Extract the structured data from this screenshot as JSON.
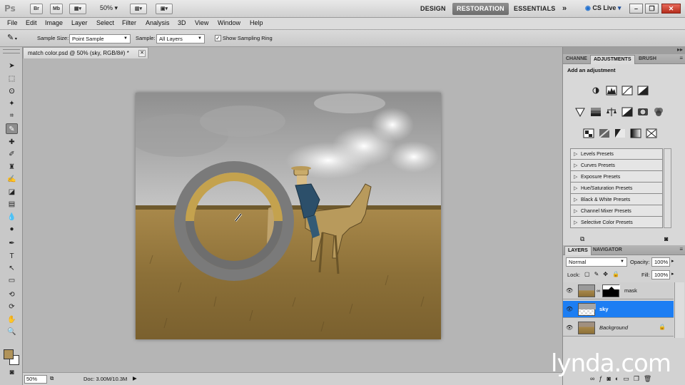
{
  "app": {
    "logo": "Ps",
    "bridge_btn": "Br",
    "minibridge_btn": "Mb",
    "zoom": "50%",
    "workspaces": [
      "DESIGN",
      "RESTORATION",
      "ESSENTIALS"
    ],
    "active_workspace": "RESTORATION",
    "more_workspaces": "»",
    "cs_live": "CS Live"
  },
  "menu": [
    "File",
    "Edit",
    "Image",
    "Layer",
    "Select",
    "Filter",
    "Analysis",
    "3D",
    "View",
    "Window",
    "Help"
  ],
  "options": {
    "sample_size_label": "Sample Size:",
    "sample_size_value": "Point Sample",
    "sample_label": "Sample:",
    "sample_value": "All Layers",
    "show_ring_label": "Show Sampling Ring"
  },
  "document": {
    "tab_title": "match color.psd @ 50% (sky, RGB/8#) *",
    "status_zoom": "50%",
    "status_doc": "Doc: 3.00M/10.3M"
  },
  "colors": {
    "foreground": "#b0935a",
    "background": "#ffffff",
    "ring_top": "#c4a24e",
    "ring_bottom": "#6e6e6e"
  },
  "adjustments": {
    "tabs": [
      "CHANNE",
      "ADJUSTMENTS",
      "BRUSH"
    ],
    "header": "Add an adjustment",
    "presets": [
      "Levels Presets",
      "Curves Presets",
      "Exposure Presets",
      "Hue/Saturation Presets",
      "Black & White Presets",
      "Channel Mixer Presets",
      "Selective Color Presets"
    ]
  },
  "layers": {
    "tabs": [
      "LAYERS",
      "NAVIGATOR"
    ],
    "blend_mode": "Normal",
    "opacity_label": "Opacity:",
    "opacity_value": "100%",
    "lock_label": "Lock:",
    "fill_label": "Fill:",
    "fill_value": "100%",
    "items": [
      {
        "name": "mask",
        "selected": false
      },
      {
        "name": "sky",
        "selected": true
      },
      {
        "name": "Background",
        "selected": false
      }
    ]
  },
  "watermark": "lynda.com"
}
